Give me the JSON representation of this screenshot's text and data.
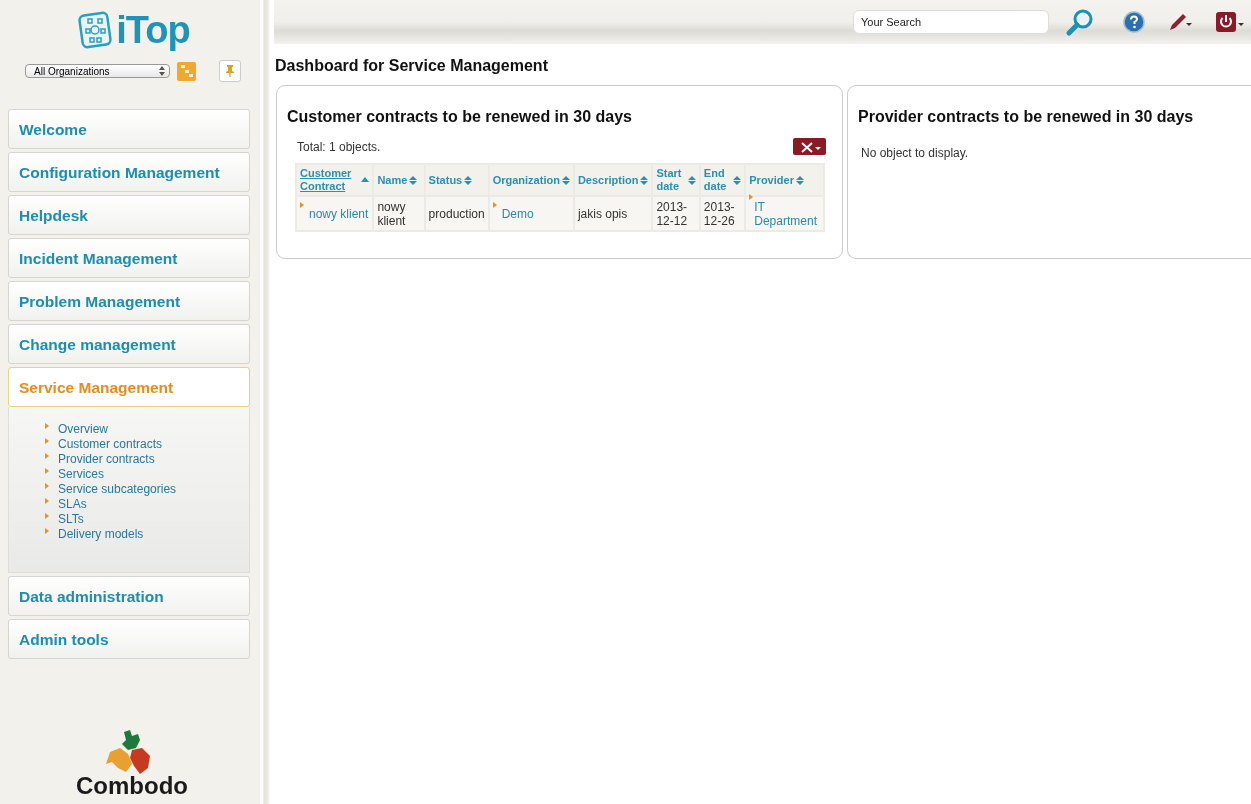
{
  "sidebar": {
    "logo": "iTop",
    "organization_select": {
      "value": "All Organizations"
    },
    "menu": [
      {
        "label": "Welcome",
        "selected": false
      },
      {
        "label": "Configuration Management",
        "selected": false
      },
      {
        "label": "Helpdesk",
        "selected": false
      },
      {
        "label": "Incident Management",
        "selected": false
      },
      {
        "label": "Problem Management",
        "selected": false
      },
      {
        "label": "Change management",
        "selected": false
      },
      {
        "label": "Service Management",
        "selected": true,
        "children": [
          {
            "label": "Overview"
          },
          {
            "label": "Customer contracts"
          },
          {
            "label": "Provider contracts"
          },
          {
            "label": "Services"
          },
          {
            "label": "Service subcategories"
          },
          {
            "label": "SLAs"
          },
          {
            "label": "SLTs"
          },
          {
            "label": "Delivery models"
          }
        ]
      },
      {
        "label": "Data administration",
        "selected": false
      },
      {
        "label": "Admin tools",
        "selected": false
      }
    ],
    "footer_logo": "Combodo"
  },
  "header": {
    "search": {
      "placeholder": "Your Search"
    }
  },
  "page_title": "Dashboard for Service Management",
  "dashlets": [
    {
      "title": "Customer contracts to be renewed in 30 days",
      "total": "Total: 1 objects.",
      "table": {
        "columns": [
          {
            "label": "Customer Contract",
            "sorted": true
          },
          {
            "label": "Name",
            "sorted": false
          },
          {
            "label": "Status",
            "sorted": false
          },
          {
            "label": "Organization",
            "sorted": false
          },
          {
            "label": "Description",
            "sorted": false
          },
          {
            "label": "Start date",
            "sorted": false
          },
          {
            "label": "End date",
            "sorted": false
          },
          {
            "label": "Provider",
            "sorted": false
          }
        ],
        "rows": [
          [
            {
              "text": "nowy klient",
              "link": true
            },
            {
              "text": "nowy klient",
              "link": false
            },
            {
              "text": "production",
              "link": false
            },
            {
              "text": "Demo",
              "link": true
            },
            {
              "text": "jakis opis",
              "link": false
            },
            {
              "text": "2013-12-12",
              "link": false
            },
            {
              "text": "2013-12-26",
              "link": false
            },
            {
              "text": "IT Department",
              "link": true
            }
          ]
        ]
      }
    },
    {
      "title": "Provider contracts to be renewed in 30 days",
      "empty_message": "No object to display."
    }
  ]
}
